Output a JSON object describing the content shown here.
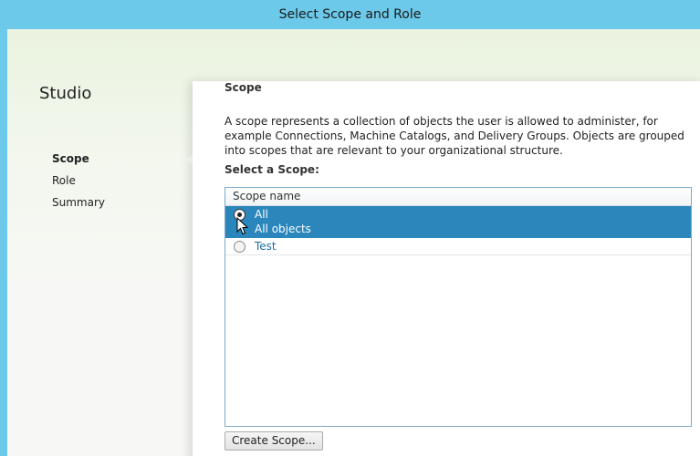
{
  "window": {
    "title": "Select Scope and Role"
  },
  "sidebar": {
    "app_name": "Studio",
    "items": [
      {
        "label": "Scope",
        "active": true
      },
      {
        "label": "Role",
        "active": false
      },
      {
        "label": "Summary",
        "active": false
      }
    ]
  },
  "main": {
    "section_title": "Scope",
    "description": "A scope represents a collection of objects the user is allowed to administer, for example Connections, Machine Catalogs, and Delivery Groups. Objects are grouped into scopes that are relevant to your organizational structure.",
    "select_label": "Select a Scope:",
    "list": {
      "column_header": "Scope name",
      "rows": [
        {
          "name": "All",
          "description": "All objects",
          "selected": true
        },
        {
          "name": "Test",
          "description": "",
          "selected": false
        }
      ]
    },
    "create_button": "Create Scope..."
  },
  "colors": {
    "titlebar": "#6cc9e9",
    "selection": "#2a86bb",
    "link": "#1f6fa5"
  }
}
